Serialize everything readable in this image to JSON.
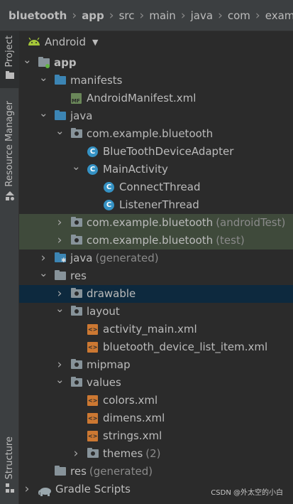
{
  "breadcrumb": [
    "bluetooth",
    "app",
    "src",
    "main",
    "java",
    "com",
    "example"
  ],
  "sidebar": {
    "project_tab": "Project",
    "resource_manager_tab": "Resource Manager",
    "structure_tab": "Structure"
  },
  "header": {
    "view_mode": "Android"
  },
  "tree": [
    {
      "label": "app",
      "bold": true,
      "indent": 0,
      "chevron": "down",
      "icon": "module"
    },
    {
      "label": "manifests",
      "indent": 1,
      "chevron": "down",
      "icon": "folder-blue"
    },
    {
      "label": "AndroidManifest.xml",
      "indent": 2,
      "chevron": "",
      "icon": "manifest"
    },
    {
      "label": "java",
      "indent": 1,
      "chevron": "down",
      "icon": "folder-blue"
    },
    {
      "label": "com.example.bluetooth",
      "indent": 2,
      "chevron": "down",
      "icon": "package"
    },
    {
      "label": "BlueToothDeviceAdapter",
      "indent": 3,
      "chevron": "",
      "icon": "class"
    },
    {
      "label": "MainActivity",
      "indent": 3,
      "chevron": "down",
      "icon": "class"
    },
    {
      "label": "ConnectThread",
      "indent": 4,
      "chevron": "",
      "icon": "class"
    },
    {
      "label": "ListenerThread",
      "indent": 4,
      "chevron": "",
      "icon": "class"
    },
    {
      "label": "com.example.bluetooth",
      "suffix": "(androidTest)",
      "indent": 2,
      "chevron": "right",
      "icon": "package",
      "highlight": true
    },
    {
      "label": "com.example.bluetooth",
      "suffix": "(test)",
      "indent": 2,
      "chevron": "right",
      "icon": "package",
      "highlight": true
    },
    {
      "label": "java",
      "suffix": "(generated)",
      "indent": 1,
      "chevron": "right",
      "icon": "folder-gen"
    },
    {
      "label": "res",
      "indent": 1,
      "chevron": "down",
      "icon": "folder"
    },
    {
      "label": "drawable",
      "indent": 2,
      "chevron": "right",
      "icon": "folder-pkg",
      "selected": true
    },
    {
      "label": "layout",
      "indent": 2,
      "chevron": "down",
      "icon": "folder-pkg"
    },
    {
      "label": "activity_main.xml",
      "indent": 3,
      "chevron": "",
      "icon": "xml"
    },
    {
      "label": "bluetooth_device_list_item.xml",
      "indent": 3,
      "chevron": "",
      "icon": "xml"
    },
    {
      "label": "mipmap",
      "indent": 2,
      "chevron": "right",
      "icon": "folder-pkg"
    },
    {
      "label": "values",
      "indent": 2,
      "chevron": "down",
      "icon": "folder-pkg"
    },
    {
      "label": "colors.xml",
      "indent": 3,
      "chevron": "",
      "icon": "xml"
    },
    {
      "label": "dimens.xml",
      "indent": 3,
      "chevron": "",
      "icon": "xml"
    },
    {
      "label": "strings.xml",
      "indent": 3,
      "chevron": "",
      "icon": "xml"
    },
    {
      "label": "themes",
      "suffix": "(2)",
      "indent": 3,
      "chevron": "right",
      "icon": "folder-pkg"
    },
    {
      "label": "res",
      "suffix": "(generated)",
      "indent": 1,
      "chevron": "",
      "icon": "folder"
    },
    {
      "label": "Gradle Scripts",
      "indent": 0,
      "chevron": "right",
      "icon": "gradle"
    }
  ],
  "watermark": "CSDN @外太空的小白",
  "colors": {
    "highlight_row": "#3f4a3b",
    "selected_row": "#0d293e",
    "background": "#2b2b2b"
  }
}
